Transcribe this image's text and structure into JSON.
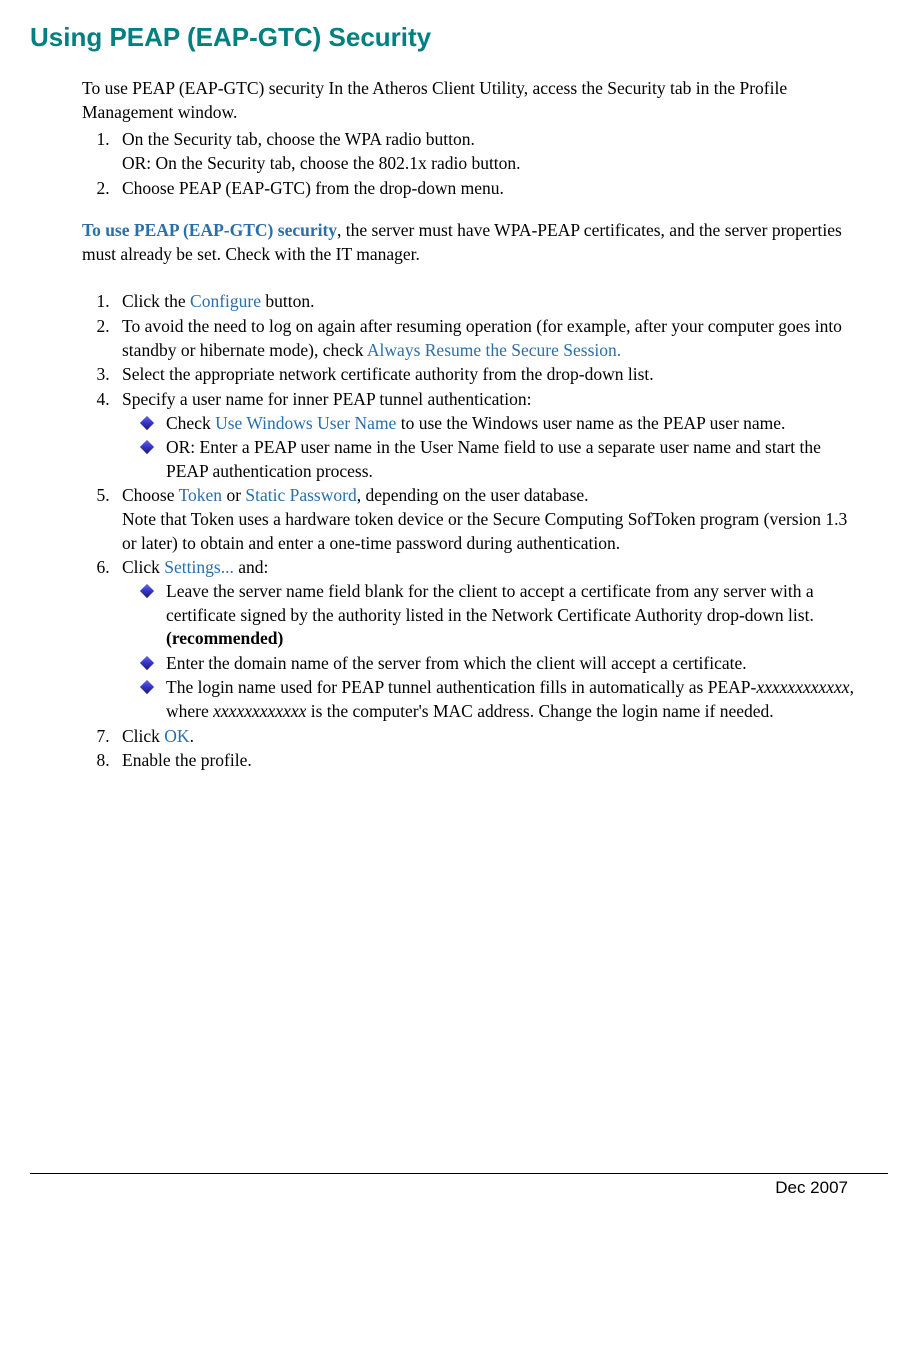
{
  "title": "Using PEAP (EAP-GTC) Security",
  "intro": "To use PEAP (EAP-GTC) security In the Atheros Client Utility, access the Security tab in the Profile Management window.",
  "firstList": {
    "item1a": "On the Security tab, choose the WPA radio button.",
    "item1b": "OR: On the Security tab, choose the 802.1x radio button.",
    "item2": "Choose PEAP (EAP-GTC) from the drop-down menu."
  },
  "midPara": {
    "bold": "To use PEAP (EAP-GTC) security",
    "rest": ", the server must have WPA-PEAP certificates, and the server properties must already be set. Check with the IT manager."
  },
  "secondList": {
    "s1a": "Click the ",
    "s1link": "Configure",
    "s1b": " button.",
    "s2a": "To avoid the need to log on again after resuming operation (for example, after your computer goes into standby or hibernate mode), check ",
    "s2link": "Always Resume the Secure Session.",
    "s3": "Select the appropriate network certificate authority from the drop-down list.",
    "s4": "Specify a user name for inner PEAP tunnel authentication:",
    "s4b1a": "Check ",
    "s4b1link": "Use Windows User Name",
    "s4b1b": " to use the Windows user name as the PEAP user name.",
    "s4b2": "OR: Enter a PEAP user name in the User Name field to use a separate user name and start the PEAP authentication process.",
    "s5a": "Choose ",
    "s5link1": "Token",
    "s5b": " or ",
    "s5link2": "Static Password",
    "s5c": ", depending on the user database.",
    "s5d": "Note that Token uses a hardware token device or the Secure Computing SofToken program (version 1.3 or later) to obtain and enter a one-time password during authentication.",
    "s6a": "Click ",
    "s6link": "Settings...",
    "s6b": " and:",
    "s6b1a": "Leave the server name field blank for the client to accept a certificate from any server with a certificate signed by the authority listed in the Network Certificate Authority drop-down list. ",
    "s6b1bold": "(recommended)",
    "s6b2": "Enter the domain name of the server from which the client will accept a certificate.",
    "s6b3a": "The login name used for PEAP tunnel authentication fills in automatically as PEAP-",
    "s6b3i1": "xxxxxxxxxxxx",
    "s6b3b": ", where ",
    "s6b3i2": "xxxxxxxxxxxx",
    "s6b3c": " is the computer's MAC address.  Change the login name if needed.",
    "s7a": "Click ",
    "s7link": "OK",
    "s7b": ".",
    "s8": "Enable the profile."
  },
  "footer": "Dec 2007"
}
